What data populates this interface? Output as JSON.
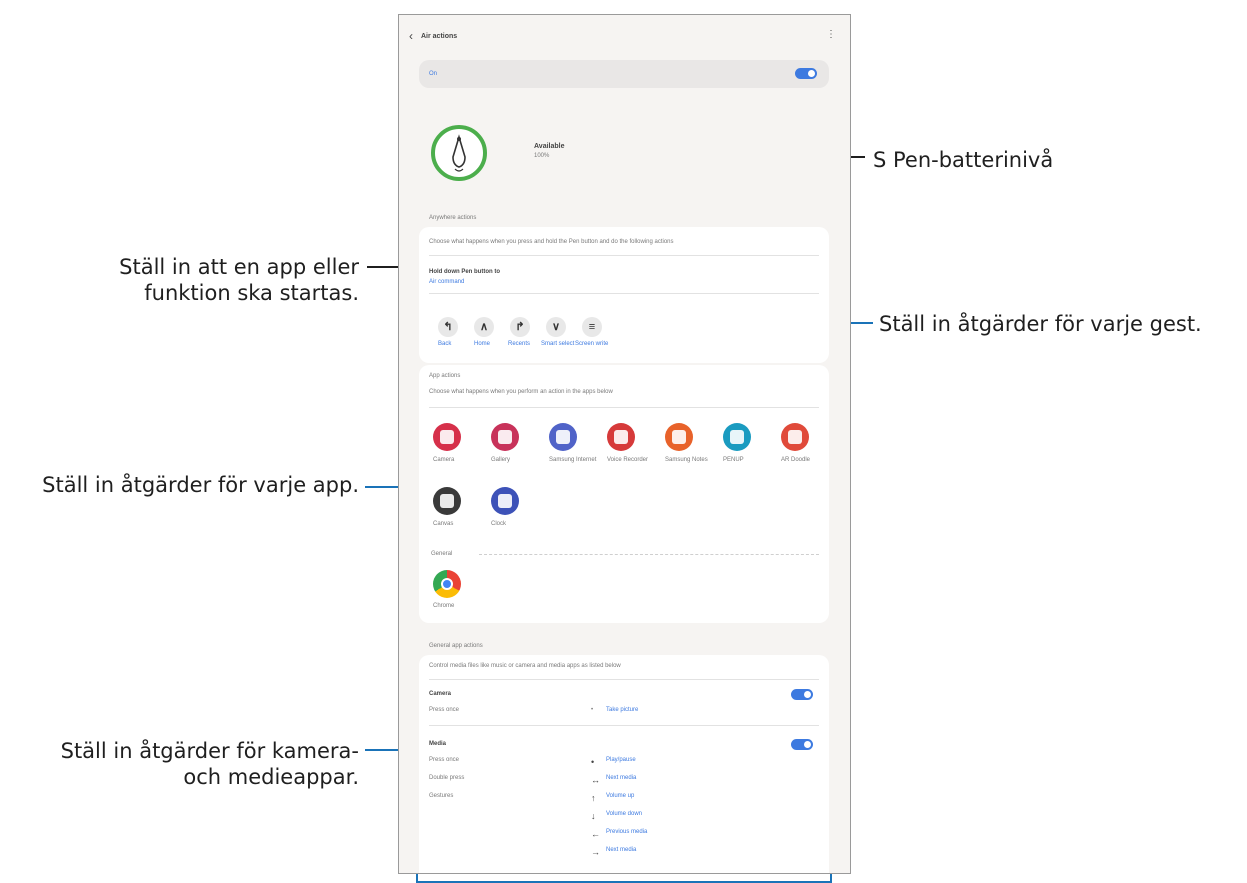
{
  "callouts": {
    "battery": "S Pen-batterinivå",
    "start_line1": "Ställ in att en app eller",
    "start_line2": "funktion ska startas.",
    "gestures": "Ställ in åtgärder för varje gest.",
    "apps": "Ställ in åtgärder för varje app.",
    "media_line1": "Ställ in åtgärder för kamera-",
    "media_line2": "och medieappar."
  },
  "phone": {
    "title": "Air actions",
    "master_label": "On",
    "battery_title": "Available",
    "battery_sub": "100%",
    "anywhere_header": "Anywhere actions",
    "anywhere_desc": "Choose what happens when you press and hold the Pen button and do the following actions",
    "pen_button_label": "Hold down Pen button to",
    "pen_button_value": "Air command",
    "gestures": [
      {
        "glyph": "↰",
        "label": "Back"
      },
      {
        "glyph": "∧",
        "label": "Home"
      },
      {
        "glyph": "↱",
        "label": "Recents"
      },
      {
        "glyph": "∨",
        "label": "Smart select"
      },
      {
        "glyph": "≡",
        "label": "Screen write"
      }
    ],
    "app_header": "App actions",
    "app_desc": "Choose what happens when you perform an action in the apps below",
    "apps": [
      {
        "name": "Camera",
        "color": "#d6304a"
      },
      {
        "name": "Gallery",
        "color": "#c8325a"
      },
      {
        "name": "Samsung Internet",
        "color": "#5063c8"
      },
      {
        "name": "Voice Recorder",
        "color": "#d63a3a"
      },
      {
        "name": "Samsung Notes",
        "color": "#e8622a"
      },
      {
        "name": "PENUP",
        "color": "#1a9bc0"
      },
      {
        "name": "AR Doodle",
        "color": "#e04a3a"
      },
      {
        "name": "Canvas",
        "color": "#3a3a3a"
      },
      {
        "name": "Clock",
        "color": "#3d52b8"
      }
    ],
    "general_label": "General",
    "chrome_name": "Chrome",
    "chrome_color": "#4285f4",
    "general_section_header": "General app actions",
    "general_desc": "Control media files like music or camera and media apps as listed below",
    "camera_label": "Camera",
    "camera_row_label": "Press once",
    "camera_row_value": "Take picture",
    "media_label": "Media",
    "media_rows": [
      {
        "label": "Press once",
        "arrow": "•",
        "value": "Play/pause"
      },
      {
        "label": "Double press",
        "arrow": "↔",
        "value": "Next media"
      },
      {
        "label": "Gestures",
        "arrow": "↑",
        "value": "Volume up"
      },
      {
        "label": "",
        "arrow": "↓",
        "value": "Volume down"
      },
      {
        "label": "",
        "arrow": "←",
        "value": "Previous media"
      },
      {
        "label": "",
        "arrow": "→",
        "value": "Next media"
      }
    ]
  },
  "colors": {
    "accent": "#1a73b8",
    "battery_ring": "#4cae4c",
    "toggle": "#3d7ae0"
  }
}
